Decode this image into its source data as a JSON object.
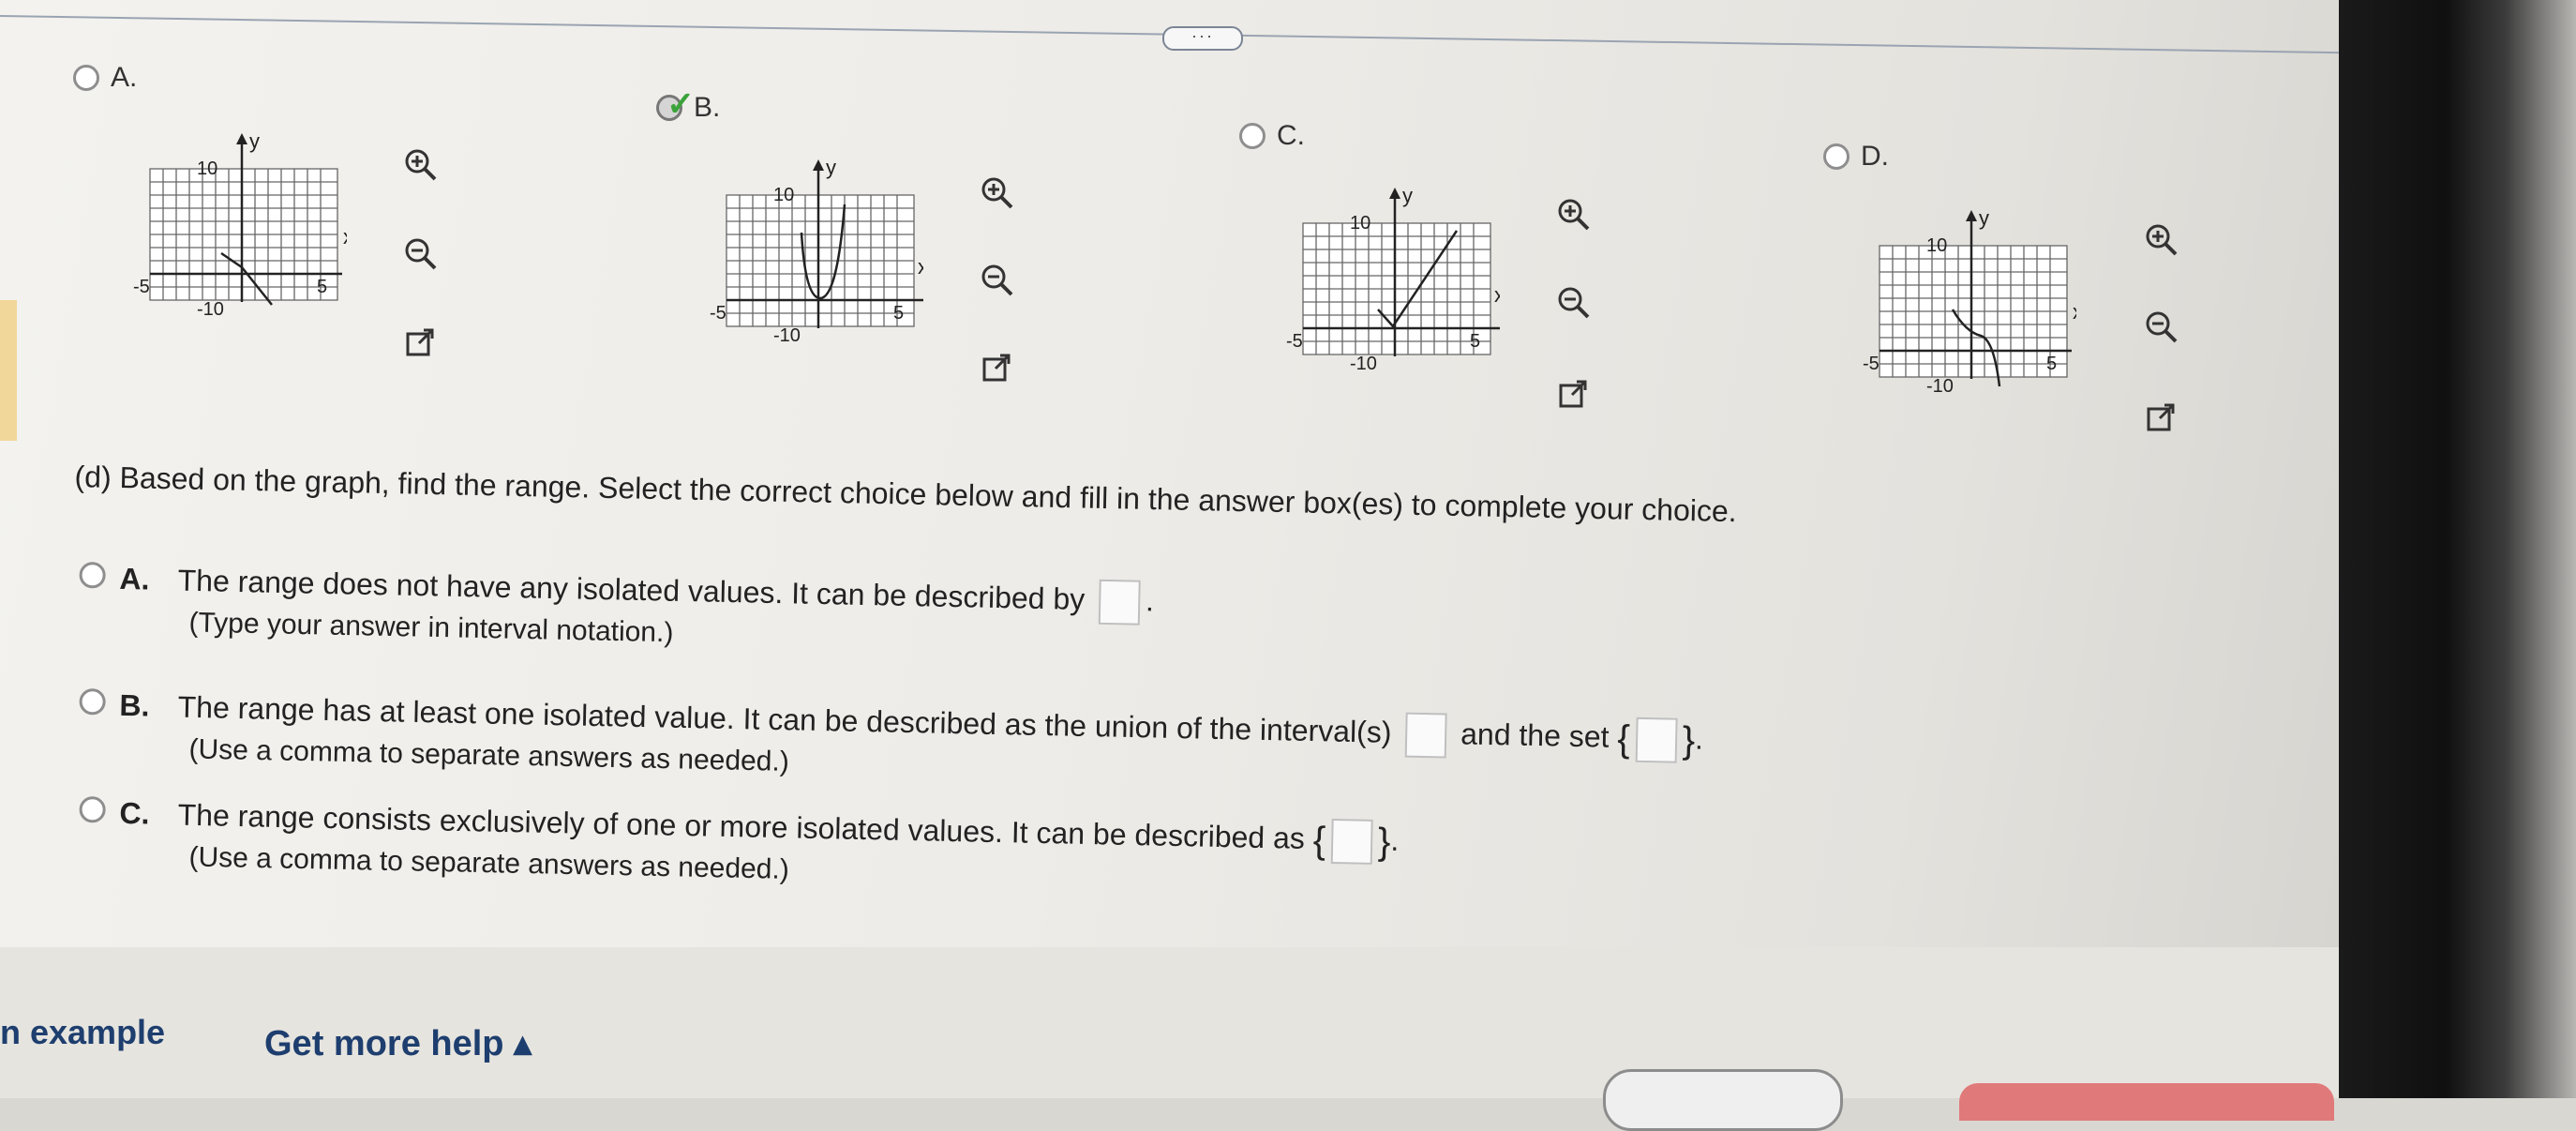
{
  "toolbar": {
    "more_label": "···"
  },
  "graph_options": [
    {
      "letter": "A.",
      "selected": false
    },
    {
      "letter": "B.",
      "selected": true
    },
    {
      "letter": "C.",
      "selected": false
    },
    {
      "letter": "D.",
      "selected": false
    }
  ],
  "axis_labels": {
    "y": "y",
    "x": "x",
    "ten": "10",
    "neg_ten": "-10",
    "five": "5",
    "neg_five": "-5"
  },
  "question": {
    "prompt": "(d) Based on the graph, find the range. Select the correct choice below and fill in the answer box(es) to complete your choice.",
    "choices": [
      {
        "letter": "A.",
        "text_before": "The range does not have any isolated values. It can be described by",
        "text_after": ".",
        "sub": "(Type your answer in interval notation.)"
      },
      {
        "letter": "B.",
        "text_before": "The range has at least one isolated value. It can be described as the union of the interval(s)",
        "text_mid": "and the set",
        "text_after": ".",
        "sub": "(Use a comma to separate answers as needed.)"
      },
      {
        "letter": "C.",
        "text_before": "The range consists exclusively of one or more isolated values. It can be described as",
        "text_after": ".",
        "sub": "(Use a comma to separate answers as needed.)"
      }
    ]
  },
  "footer": {
    "example_label": "n example",
    "help_label": "Get more help ▴"
  },
  "colors": {
    "link": "#1d3e6e",
    "check": "#3ba33b",
    "grid": "#555555"
  }
}
